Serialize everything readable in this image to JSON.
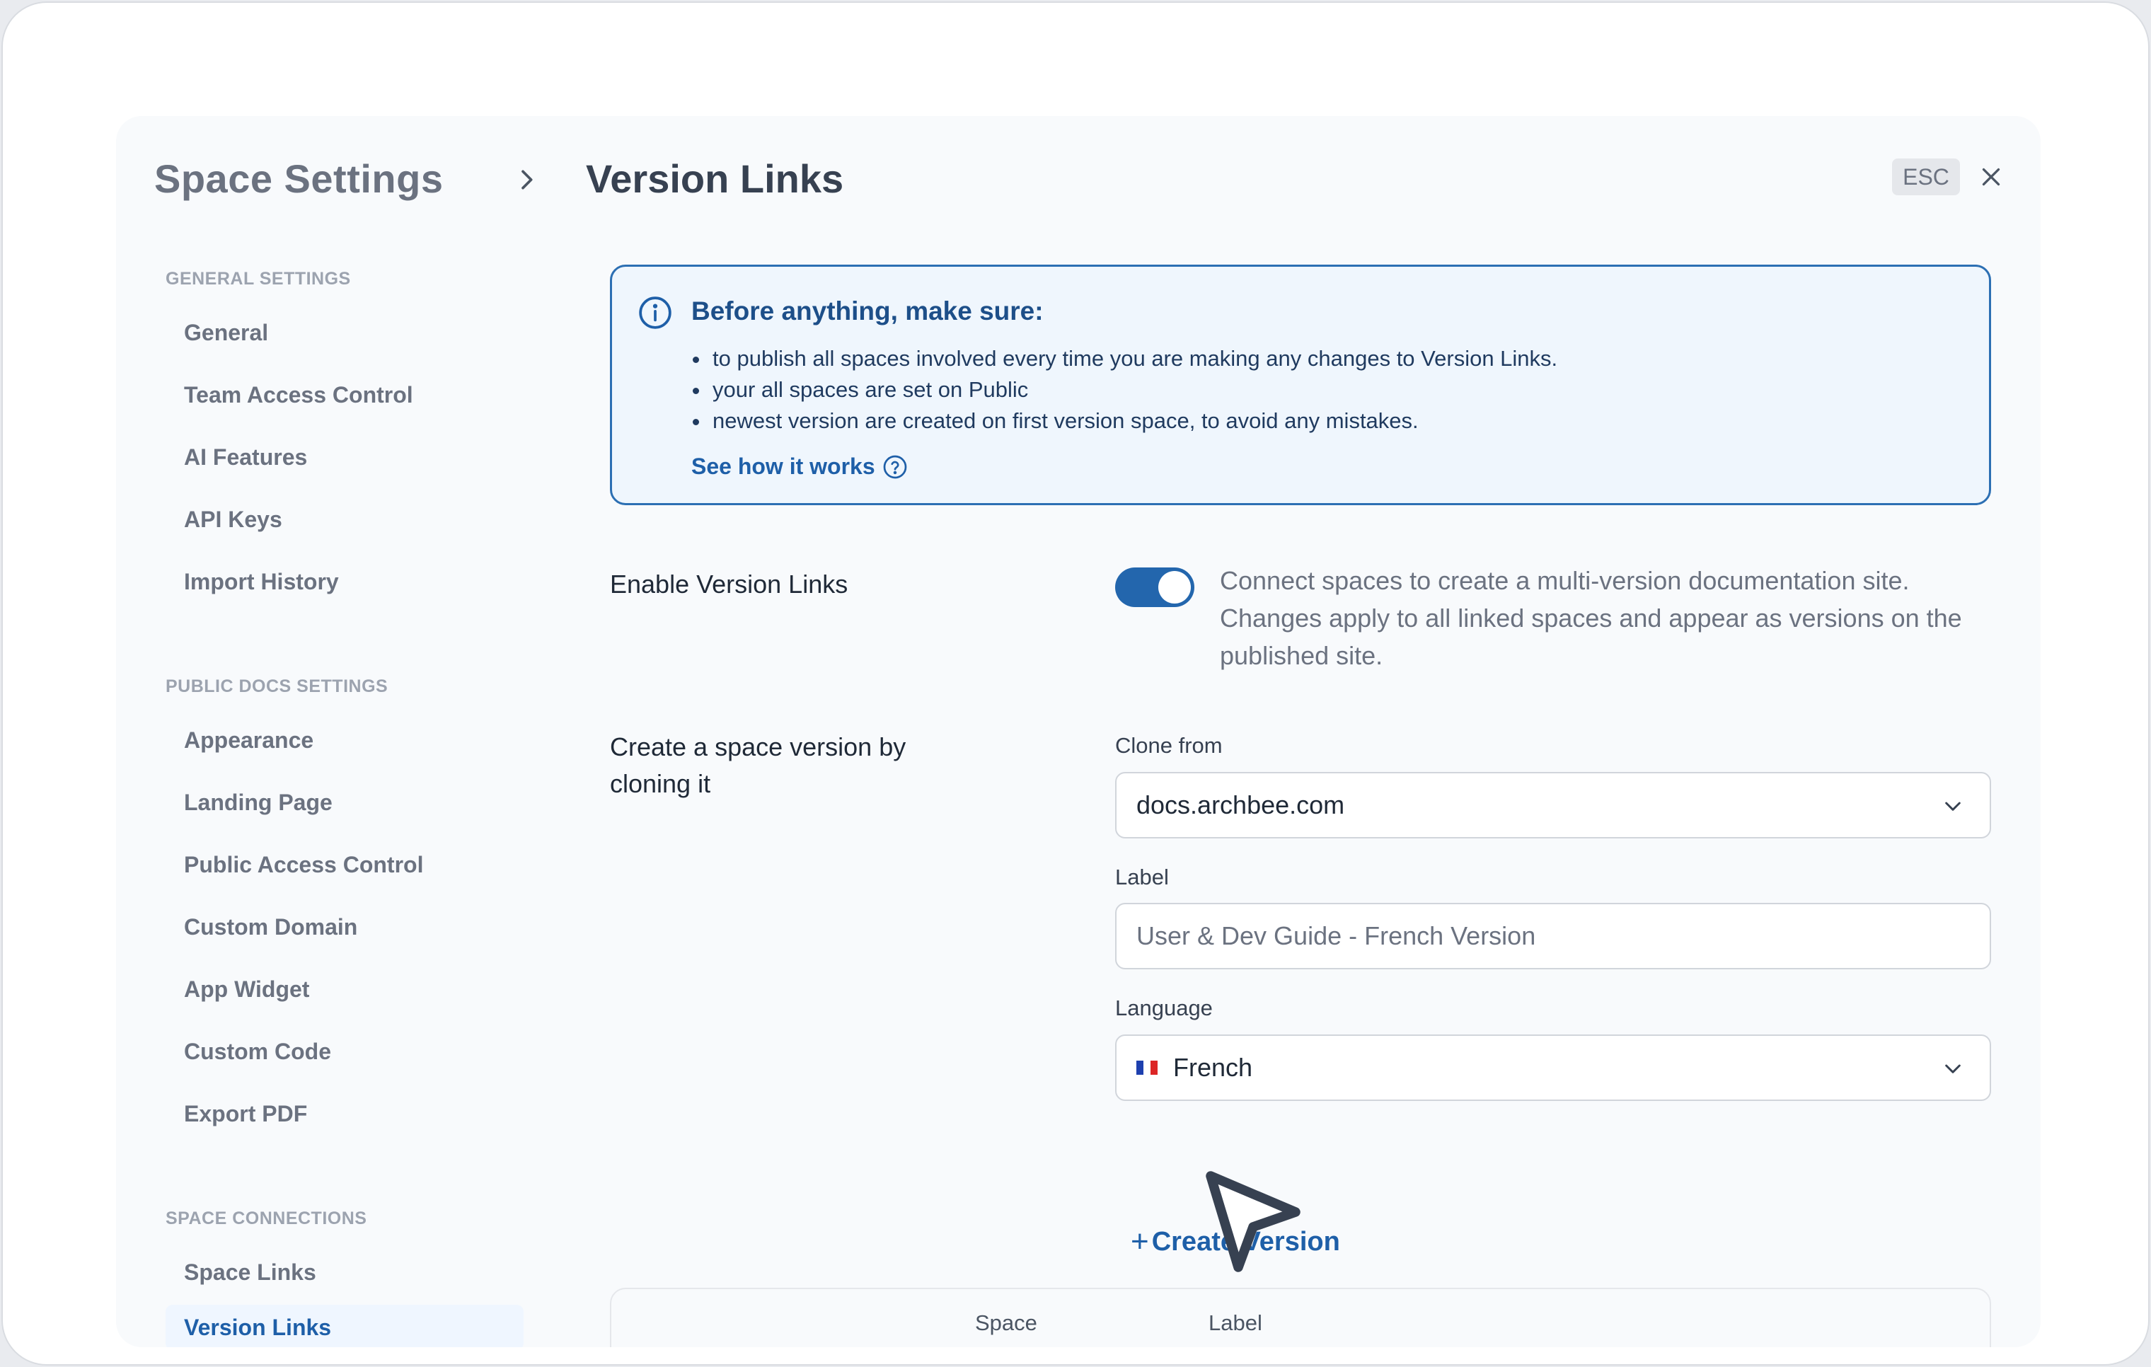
{
  "header": {
    "settings_title": "Space Settings",
    "page_title": "Version Links",
    "esc_label": "ESC"
  },
  "sidebar": {
    "sections": [
      {
        "heading": "GENERAL SETTINGS",
        "items": [
          "General",
          "Team Access Control",
          "AI Features",
          "API Keys",
          "Import History"
        ]
      },
      {
        "heading": "PUBLIC DOCS SETTINGS",
        "items": [
          "Appearance",
          "Landing Page",
          "Public Access Control",
          "Custom Domain",
          "App Widget",
          "Custom Code",
          "Export PDF"
        ]
      },
      {
        "heading": "SPACE CONNECTIONS",
        "items": [
          "Space Links",
          "Version Links"
        ]
      }
    ],
    "active_item": "Version Links"
  },
  "info": {
    "title": "Before anything, make sure:",
    "bullets": [
      "to publish all spaces involved every time you are making any changes to Version Links.",
      "your all spaces are set on Public",
      "newest version are created on first version space, to avoid any mistakes."
    ],
    "link": "See how it works"
  },
  "enable": {
    "label": "Enable Version Links",
    "enabled": true,
    "description": "Connect spaces to create a multi-version documentation site. Changes apply to all linked spaces and appear as versions on the published site."
  },
  "create": {
    "label": "Create a space version by cloning it",
    "clone_from_label": "Clone from",
    "clone_from_value": "docs.archbee.com",
    "label_label": "Label",
    "label_placeholder": "User & Dev Guide - French Version",
    "language_label": "Language",
    "language_value": "French",
    "create_button": "Create Version"
  },
  "table": {
    "columns": [
      "Space",
      "Label"
    ]
  },
  "colors": {
    "accent": "#1e5fa8",
    "toggle_on": "#2366ad",
    "info_border": "#2c6fb3"
  }
}
